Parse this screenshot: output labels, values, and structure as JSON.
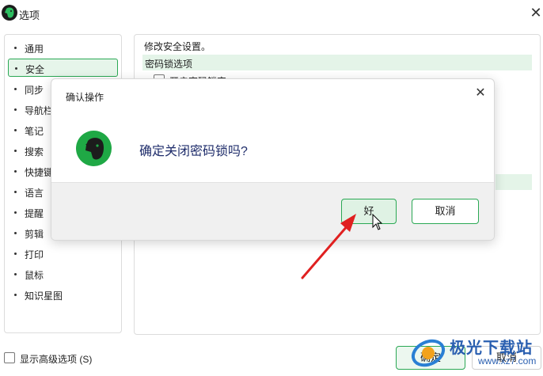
{
  "window": {
    "title": "选项",
    "close_glyph": "✕",
    "logo_icon": "evernote-elephant-icon"
  },
  "sidebar": {
    "items": [
      {
        "label": "通用",
        "active": false
      },
      {
        "label": "安全",
        "active": true
      },
      {
        "label": "同步",
        "active": false
      },
      {
        "label": "导航栏",
        "active": false
      },
      {
        "label": "笔记",
        "active": false
      },
      {
        "label": "搜索",
        "active": false
      },
      {
        "label": "快捷键",
        "active": false
      },
      {
        "label": "语言",
        "active": false
      },
      {
        "label": "提醒",
        "active": false
      },
      {
        "label": "剪辑",
        "active": false
      },
      {
        "label": "打印",
        "active": false
      },
      {
        "label": "鼠标",
        "active": false
      },
      {
        "label": "知识星图",
        "active": false
      }
    ]
  },
  "main": {
    "heading": "修改安全设置。",
    "section_label": "密码锁选项",
    "option_label": "开启密码锁定"
  },
  "footer": {
    "advanced_label": "显示高级选项 (S)",
    "ok_label": "确定",
    "cancel_label": "取消"
  },
  "dialog": {
    "title": "确认操作",
    "close_glyph": "✕",
    "message": "确定关闭密码锁吗?",
    "ok_label": "好",
    "cancel_label": "取消",
    "icon": "evernote-elephant-icon"
  },
  "annotation": {
    "arrow_color": "#e02020",
    "icon": "red-arrow-icon"
  },
  "watermark": {
    "brand": "极光下载站",
    "url": "www.xz7.com"
  },
  "colors": {
    "accent_green": "#2aa854",
    "selected_bg": "#e6f5ea",
    "dialog_text": "#1f2d6b"
  }
}
